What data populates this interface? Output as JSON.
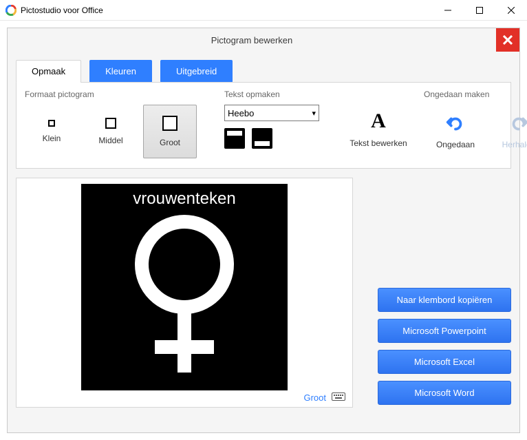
{
  "titlebar": {
    "title": "Pictostudio voor Office"
  },
  "panel": {
    "title": "Pictogram bewerken"
  },
  "tabs": [
    {
      "label": "Opmaak",
      "active": true
    },
    {
      "label": "Kleuren",
      "active": false
    },
    {
      "label": "Uitgebreid",
      "active": false
    }
  ],
  "format_section": {
    "label": "Formaat pictogram",
    "sizes": [
      {
        "label": "Klein"
      },
      {
        "label": "Middel"
      },
      {
        "label": "Groot"
      }
    ],
    "selected": 2
  },
  "text_section": {
    "label": "Tekst opmaken",
    "font": "Heebo",
    "edit_label": "Tekst bewerken"
  },
  "undo_section": {
    "label": "Ongedaan maken",
    "undo_label": "Ongedaan",
    "redo_label": "Herhalen"
  },
  "preview": {
    "picto_text": "vrouwenteken",
    "size_label": "Groot"
  },
  "exports": {
    "clipboard": "Naar klembord kopiëren",
    "powerpoint": "Microsoft Powerpoint",
    "excel": "Microsoft Excel",
    "word": "Microsoft Word"
  }
}
